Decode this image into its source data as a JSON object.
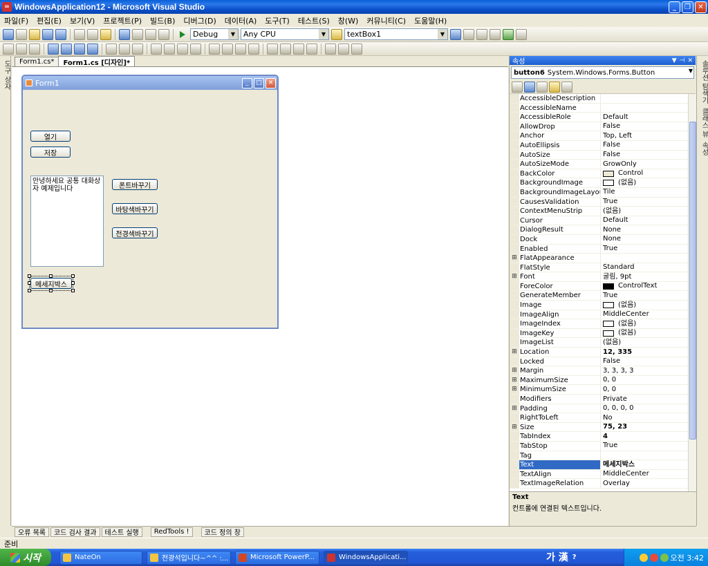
{
  "window": {
    "title": "WindowsApplication12 - Microsoft Visual Studio"
  },
  "menu": [
    "파일(F)",
    "편집(E)",
    "보기(V)",
    "프로젝트(P)",
    "빌드(B)",
    "디버그(D)",
    "데이터(A)",
    "도구(T)",
    "테스트(S)",
    "창(W)",
    "커뮤니티(C)",
    "도움말(H)"
  ],
  "toolbar": {
    "config": "Debug",
    "platform": "Any CPU",
    "find": "textBox1"
  },
  "left_strip_label": "도구 상자",
  "tabs": [
    "Form1.cs*",
    "Form1.cs [디자인]*"
  ],
  "designer": {
    "form_title": "Form1",
    "buttons": [
      "열기",
      "저장",
      "폰트바꾸기",
      "바탕색바꾸기",
      "전경색바꾸기",
      "메세지박스"
    ],
    "textbox_text": "안녕하세요 공통 대화상자 예제입니다"
  },
  "properties": {
    "header": "속성",
    "object_name": "button6",
    "object_type": "System.Windows.Forms.Button",
    "rows": [
      {
        "k": "AccessibleDescription",
        "v": ""
      },
      {
        "k": "AccessibleName",
        "v": ""
      },
      {
        "k": "AccessibleRole",
        "v": "Default"
      },
      {
        "k": "AllowDrop",
        "v": "False"
      },
      {
        "k": "Anchor",
        "v": "Top, Left"
      },
      {
        "k": "AutoEllipsis",
        "v": "False"
      },
      {
        "k": "AutoSize",
        "v": "False"
      },
      {
        "k": "AutoSizeMode",
        "v": "GrowOnly"
      },
      {
        "k": "BackColor",
        "v": "Control"
      },
      {
        "k": "BackgroundImage",
        "v": "(없음)"
      },
      {
        "k": "BackgroundImageLayout",
        "v": "Tile"
      },
      {
        "k": "CausesValidation",
        "v": "True"
      },
      {
        "k": "ContextMenuStrip",
        "v": "(없음)"
      },
      {
        "k": "Cursor",
        "v": "Default"
      },
      {
        "k": "DialogResult",
        "v": "None"
      },
      {
        "k": "Dock",
        "v": "None"
      },
      {
        "k": "Enabled",
        "v": "True"
      },
      {
        "k": "FlatAppearance",
        "v": ""
      },
      {
        "k": "FlatStyle",
        "v": "Standard"
      },
      {
        "k": "Font",
        "v": "굴림, 9pt"
      },
      {
        "k": "ForeColor",
        "v": "ControlText"
      },
      {
        "k": "GenerateMember",
        "v": "True"
      },
      {
        "k": "Image",
        "v": "(없음)"
      },
      {
        "k": "ImageAlign",
        "v": "MiddleCenter"
      },
      {
        "k": "ImageIndex",
        "v": "(없음)"
      },
      {
        "k": "ImageKey",
        "v": "(없음)"
      },
      {
        "k": "ImageList",
        "v": "(없음)"
      },
      {
        "k": "Location",
        "v": "12, 335"
      },
      {
        "k": "Locked",
        "v": "False"
      },
      {
        "k": "Margin",
        "v": "3, 3, 3, 3"
      },
      {
        "k": "MaximumSize",
        "v": "0, 0"
      },
      {
        "k": "MinimumSize",
        "v": "0, 0"
      },
      {
        "k": "Modifiers",
        "v": "Private"
      },
      {
        "k": "Padding",
        "v": "0, 0, 0, 0"
      },
      {
        "k": "RightToLeft",
        "v": "No"
      },
      {
        "k": "Size",
        "v": "75, 23"
      },
      {
        "k": "TabIndex",
        "v": "4"
      },
      {
        "k": "TabStop",
        "v": "True"
      },
      {
        "k": "Tag",
        "v": ""
      },
      {
        "k": "Text",
        "v": "메세지박스"
      },
      {
        "k": "TextAlign",
        "v": "MiddleCenter"
      },
      {
        "k": "TextImageRelation",
        "v": "Overlay"
      }
    ],
    "desc_title": "Text",
    "desc_body": "컨트롤에 연결된 텍스트입니다."
  },
  "right_strip_labels": [
    "솔루션 탐색기",
    "클래스 뷰",
    "속성"
  ],
  "bottom_tabs": [
    "오류 목록",
    "코드 검사 결과",
    "테스트 실행",
    "RedTools !",
    "코드 정의 창"
  ],
  "status": "준비",
  "taskbar": {
    "start": "시작",
    "items": [
      "NateOn",
      "전광석입니다~^^ :...",
      "Microsoft PowerP...",
      "WindowsApplicati..."
    ],
    "ime": "가 漢",
    "clock": "오전 3:42"
  }
}
